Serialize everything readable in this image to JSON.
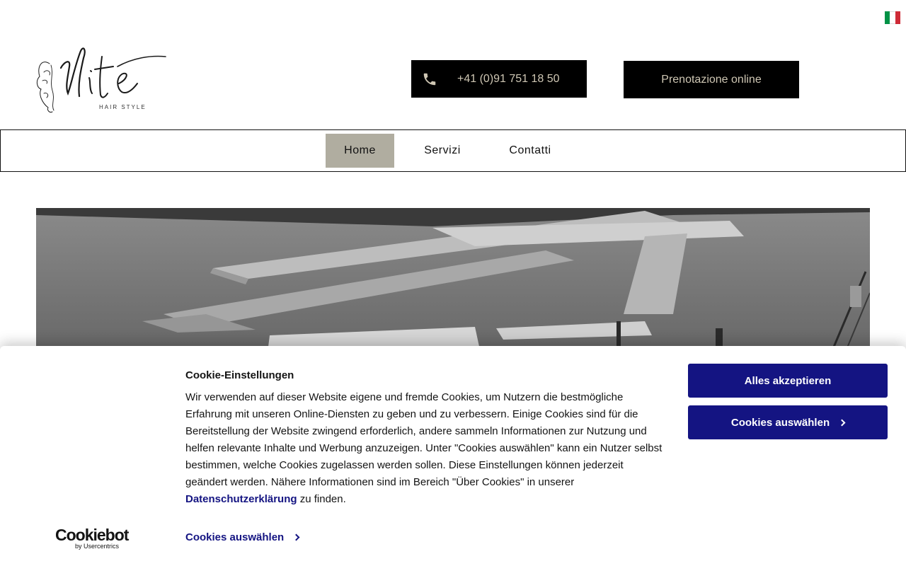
{
  "header": {
    "flag": {
      "icon": "italian-flag-icon",
      "colors": [
        "#009246",
        "#ffffff",
        "#ce2b37"
      ]
    },
    "logo": {
      "tagline": "HAIR STYLE"
    },
    "phone": {
      "icon": "phone-icon",
      "label": "+41 (0)91 751 18 50"
    },
    "booking": {
      "label": "Prenotazione online"
    }
  },
  "nav": {
    "items": [
      {
        "label": "Home",
        "active": true
      },
      {
        "label": "Servizi",
        "active": false
      },
      {
        "label": "Contatti",
        "active": false
      }
    ]
  },
  "cookie_banner": {
    "title": "Cookie-Einstellungen",
    "text_before_link": "Wir verwenden auf dieser Website eigene und fremde Cookies, um Nutzern die bestmögliche Erfahrung mit unseren Online-Diensten zu geben und zu verbessern. Einige Cookies sind für die Bereitstellung der Website zwingend erforderlich, andere sammeln Informationen zur Nutzung und helfen relevante Inhalte und Werbung anzuzeigen. Unter \"Cookies auswählen\" kann ein Nutzer selbst bestimmen, welche Cookies zugelassen werden sollen. Diese Einstellungen können jederzeit geändert werden. Nähere Informationen sind im Bereich \"Über Cookies\" in unserer ",
    "link_label": "Datenschutzerklärung",
    "text_after_link": " zu finden.",
    "accept_label": "Alles akzeptieren",
    "select_label": "Cookies auswählen",
    "select_link_label": "Cookies auswählen",
    "brand": {
      "name": "Cookiebot",
      "sub": "by Usercentrics"
    },
    "accent_color": "#141482"
  },
  "colors": {
    "nav_active": "#b0ada0",
    "button_text": "#cfc7b4"
  }
}
